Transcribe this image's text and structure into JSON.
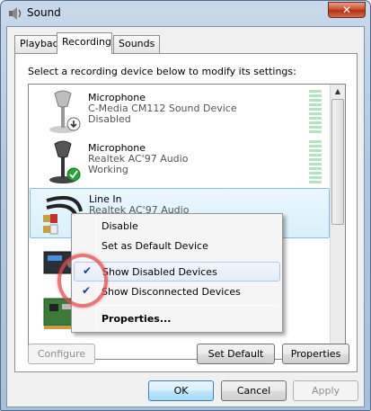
{
  "window": {
    "title": "Sound",
    "close_glyph": "✕"
  },
  "tabs": [
    {
      "label": "Playback"
    },
    {
      "label": "Recording"
    },
    {
      "label": "Sounds"
    }
  ],
  "instructions": "Select a recording device below to modify its settings:",
  "devices": [
    {
      "name": "Microphone",
      "driver": "C-Media CM112 Sound Device",
      "status": "Disabled",
      "icon": "microphone-disabled-icon"
    },
    {
      "name": "Microphone",
      "driver": "Realtek AC'97 Audio",
      "status": "Working",
      "icon": "microphone-default-icon"
    },
    {
      "name": "Line In",
      "driver": "Realtek AC'97 Audio",
      "status": "",
      "icon": "line-in-cable-icon"
    }
  ],
  "buttons": {
    "configure": "Configure",
    "set_default": "Set Default",
    "properties": "Properties",
    "ok": "OK",
    "cancel": "Cancel",
    "apply": "Apply"
  },
  "context_menu": {
    "items": [
      {
        "label": "Disable",
        "checked": false
      },
      {
        "label": "Set as Default Device",
        "checked": false
      },
      {
        "label": "Show Disabled Devices",
        "checked": true
      },
      {
        "label": "Show Disconnected Devices",
        "checked": true
      },
      {
        "label": "Properties...",
        "checked": false
      }
    ],
    "check_glyph": "✔"
  },
  "scrollbar": {
    "up_glyph": "▲",
    "down_glyph": "▼"
  },
  "colors": {
    "highlight_ring": "#e34c4c",
    "check": "#1c3e94",
    "selection": "#d9f0fc"
  }
}
